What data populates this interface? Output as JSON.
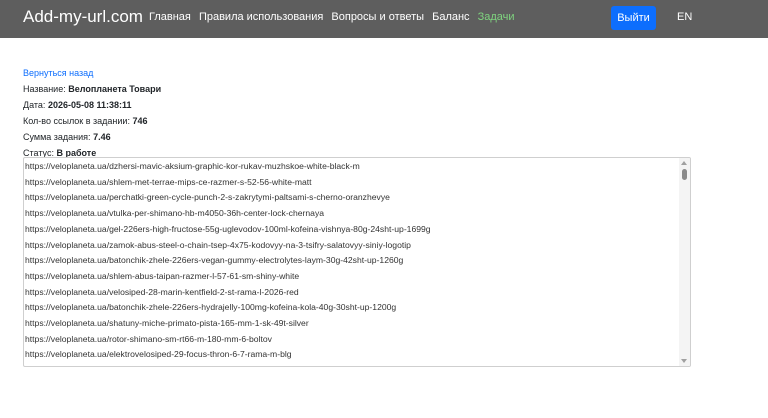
{
  "header": {
    "brand": "Add-my-url.com",
    "nav": [
      {
        "label": "Главная",
        "active": false
      },
      {
        "label": "Правила использования",
        "active": false
      },
      {
        "label": "Вопросы и ответы",
        "active": false
      },
      {
        "label": "Баланс",
        "active": false
      },
      {
        "label": "Задачи",
        "active": true
      }
    ],
    "logout_label": "Выйти",
    "lang_label": "EN"
  },
  "task": {
    "back_label": "Вернуться назад",
    "name_label": "Название:",
    "name_value": "Велопланета Товари",
    "date_label": "Дата:",
    "date_value": "2026-05-08 11:38:11",
    "links_count_label": "Кол-во ссылок в задании:",
    "links_count_value": "746",
    "sum_label": "Сумма задания:",
    "sum_value": "7.46",
    "status_label": "Статус:",
    "status_value": "В работе"
  },
  "links": [
    "https://veloplaneta.ua/dzhersi-mavic-aksium-graphic-kor-rukav-muzhskoe-white-black-m",
    "https://veloplaneta.ua/shlem-met-terrae-mips-ce-razmer-s-52-56-white-matt",
    "https://veloplaneta.ua/perchatki-green-cycle-punch-2-s-zakrytymi-paltsami-s-cherno-oranzhevye",
    "https://veloplaneta.ua/vtulka-per-shimano-hb-m4050-36h-center-lock-chernaya",
    "https://veloplaneta.ua/gel-226ers-high-fructose-55g-uglevodov-100ml-kofeina-vishnya-80g-24sht-up-1699g",
    "https://veloplaneta.ua/zamok-abus-steel-o-chain-tsep-4x75-kodovyy-na-3-tsifry-salatovyy-siniy-logotip",
    "https://veloplaneta.ua/batonchik-zhele-226ers-vegan-gummy-electrolytes-laym-30g-42sht-up-1260g",
    "https://veloplaneta.ua/shlem-abus-taipan-razmer-l-57-61-sm-shiny-white",
    "https://veloplaneta.ua/velosiped-28-marin-kentfield-2-st-rama-l-2026-red",
    "https://veloplaneta.ua/batonchik-zhele-226ers-hydrajelly-100mg-kofeina-kola-40g-30sht-up-1200g",
    "https://veloplaneta.ua/shatuny-miche-primato-pista-165-mm-1-sk-49t-silver",
    "https://veloplaneta.ua/rotor-shimano-sm-rt66-m-180-mm-6-boltov",
    "https://veloplaneta.ua/elektrovelosiped-29-focus-thron-6-7-rama-m-blg"
  ]
}
